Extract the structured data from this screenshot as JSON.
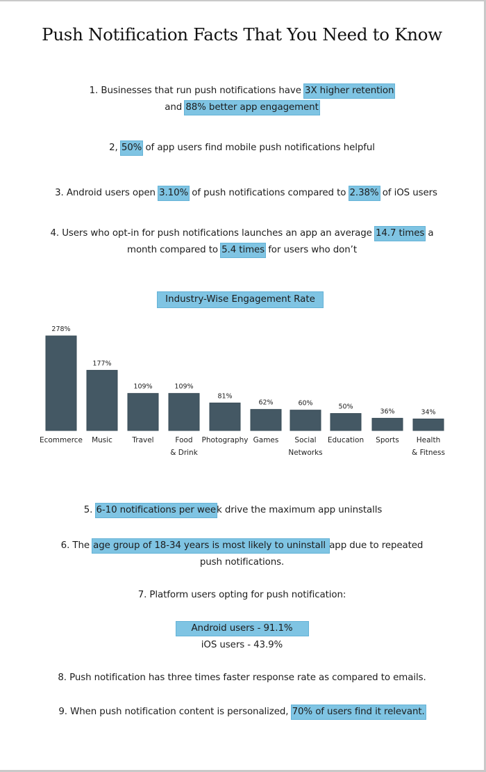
{
  "title": "Push Notification Facts That You Need to Know",
  "facts": {
    "f1": {
      "pre": "1. Businesses that run push notifications have ",
      "hl1": "3X higher retention",
      "mid": "and ",
      "hl2": "88% better app engagement"
    },
    "f2": {
      "pre": "2, ",
      "hl": "50%",
      "post": " of app users find mobile push notifications helpful"
    },
    "f3": {
      "pre": "3. Android users open ",
      "hl1": "3.10%",
      "mid": " of push notifications compared to ",
      "hl2": "2.38%",
      "post": " of iOS users"
    },
    "f4": {
      "pre": "4. Users who opt-in for push notifications launches an app an average ",
      "hl1": "14.7 times",
      "mid1": " a",
      "mid2": "month compared to ",
      "hl2": "5.4 times",
      "post": " for users who don’t"
    },
    "f5": {
      "pre": "5. ",
      "hl": "6-10 notifications per wee",
      "post": "k drive the maximum app uninstalls"
    },
    "f6": {
      "pre": "6. The ",
      "hl": "age group of 18-34 years is most likely to uninstall ",
      "post": "app due to repeated",
      "line2": "push notifications."
    },
    "f7": {
      "text": "7. Platform users opting for push notification:",
      "android": "Android users - 91.1%",
      "ios": "iOS users - 43.9%"
    },
    "f8": {
      "text": "8. Push notification has three times faster response rate as compared to emails."
    },
    "f9": {
      "pre": "9. When push notification content is personalized, ",
      "hl": "70% of users find it relevant."
    }
  },
  "colors": {
    "highlight": "#7fc4e3",
    "bar": "#445864"
  },
  "chart_data": {
    "type": "bar",
    "title": "Industry-Wise Engagement Rate",
    "xlabel": "",
    "ylabel": "",
    "categories": [
      [
        "Ecommerce"
      ],
      [
        "Music"
      ],
      [
        "Travel"
      ],
      [
        "Food",
        "& Drink"
      ],
      [
        "Photography"
      ],
      [
        "Games"
      ],
      [
        "Social",
        "Networks"
      ],
      [
        "Education"
      ],
      [
        "Sports"
      ],
      [
        "Health",
        "& Fitness"
      ]
    ],
    "values": [
      278,
      177,
      109,
      109,
      81,
      62,
      60,
      50,
      36,
      34
    ],
    "value_labels": [
      "278%",
      "177%",
      "109%",
      "109%",
      "81%",
      "62%",
      "60%",
      "50%",
      "36%",
      "34%"
    ],
    "unit": "%",
    "ylim": [
      0,
      278
    ],
    "grid": false,
    "legend": "none"
  }
}
